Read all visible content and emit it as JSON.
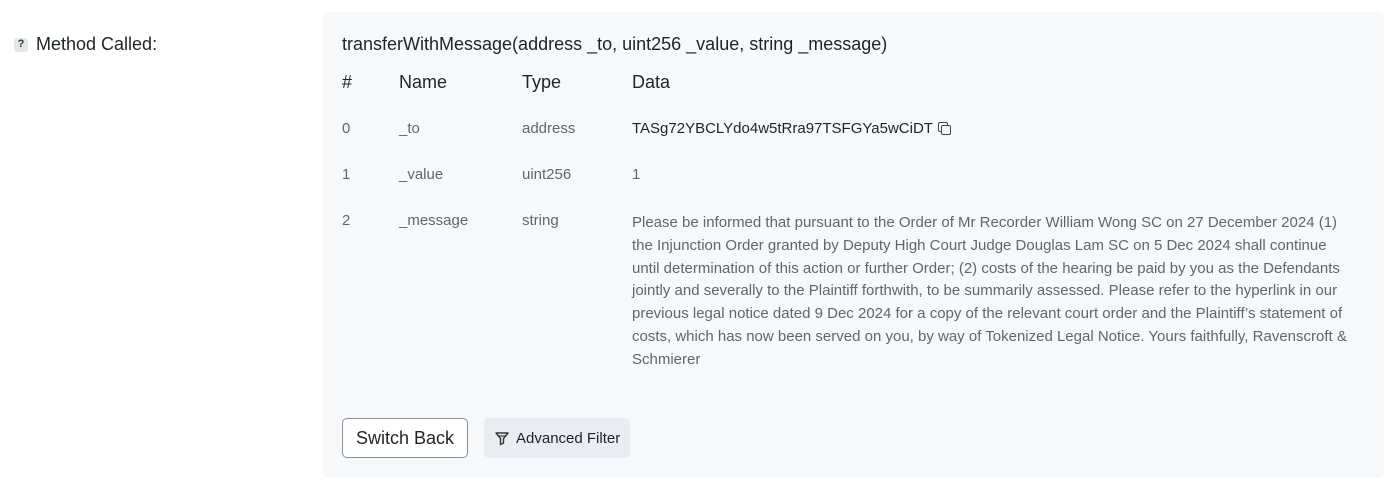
{
  "label": {
    "help_icon": "?",
    "text": "Method Called:"
  },
  "method": {
    "signature": "transferWithMessage(address _to, uint256 _value, string _message)"
  },
  "table": {
    "headers": [
      "#",
      "Name",
      "Type",
      "Data"
    ],
    "rows": [
      {
        "index": "0",
        "name": "_to",
        "type": "address",
        "data": "TASg72YBCLYdo4w5tRra97TSFGYa5wCiDT",
        "icon": "copy-icon"
      },
      {
        "index": "1",
        "name": "_value",
        "type": "uint256",
        "data": "1"
      },
      {
        "index": "2",
        "name": "_message",
        "type": "string",
        "data": "Please be informed that pursuant to the Order of Mr Recorder William Wong SC on 27 December 2024 (1) the Injunction Order granted by Deputy High Court Judge Douglas Lam SC on 5 Dec 2024 shall continue until determination of this action or further Order; (2) costs of the hearing be paid by you as the Defendants jointly and severally to the Plaintiff forthwith, to be summarily assessed. Please refer to the hyperlink in our previous legal notice dated 9 Dec 2024 for a copy of the relevant court order and the Plaintiff’s statement of costs, which has now been served on you, by way of Tokenized Legal Notice. Yours faithfully, Ravenscroft & Schmierer"
      }
    ]
  },
  "buttons": {
    "switch_back": "Switch Back",
    "advanced_filter": "Advanced Filter",
    "advanced_filter_icon": "filter-icon"
  },
  "colors": {
    "panel_bg": "#f7f8f9",
    "muted_text": "#5f6670",
    "filter_button_bg": "#e9ecf0"
  }
}
